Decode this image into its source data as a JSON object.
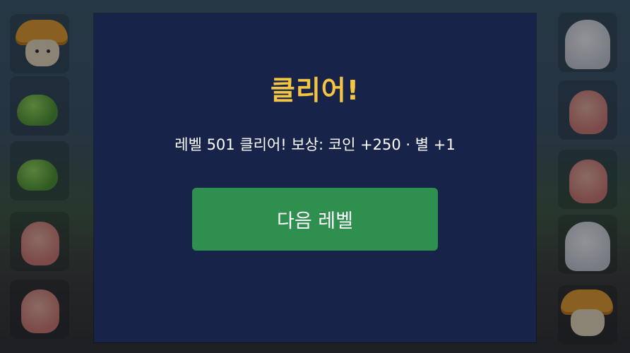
{
  "modal": {
    "title": "클리어!",
    "message": "레벨 501 클리어! 보상: 코인 +250 · 별 +1",
    "next_button": "다음 레벨"
  },
  "board": {
    "left_column": [
      "mushroom",
      "slime",
      "slime",
      "pig",
      "pig"
    ],
    "right_column": [
      "yeti",
      "pig",
      "pig",
      "yeti",
      "mushroom"
    ]
  },
  "colors": {
    "modal_bg": "#18234a",
    "title": "#f4c542",
    "button": "#2e8f4e"
  }
}
